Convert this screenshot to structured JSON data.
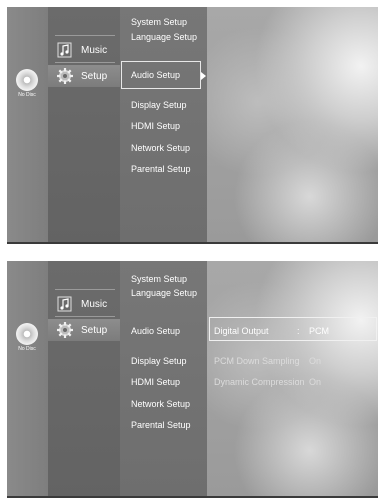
{
  "screen1": {
    "disc_label": "No Disc",
    "main_menu": [
      "Music",
      "Setup"
    ],
    "submenu": [
      "System Setup",
      "Language Setup",
      "Audio Setup",
      "Display Setup",
      "HDMI Setup",
      "Network Setup",
      "Parental Setup"
    ],
    "selected_submenu": "Audio Setup"
  },
  "screen2": {
    "disc_label": "No Disc",
    "main_menu": [
      "Music",
      "Setup"
    ],
    "submenu": [
      "System Setup",
      "Language Setup",
      "Audio Setup",
      "Display Setup",
      "HDMI Setup",
      "Network Setup",
      "Parental Setup"
    ],
    "options": [
      {
        "label": "Digital Output",
        "colon": ":",
        "value": "PCM"
      },
      {
        "label": "PCM Down Sampling",
        "colon": ":",
        "value": "On"
      },
      {
        "label": "Dynamic Compression",
        "colon": ":",
        "value": "On"
      }
    ],
    "selected_option": "Digital Output"
  },
  "icons": {
    "disc": "disc-icon",
    "music": "music-note-icon",
    "setup": "gear-icon"
  }
}
